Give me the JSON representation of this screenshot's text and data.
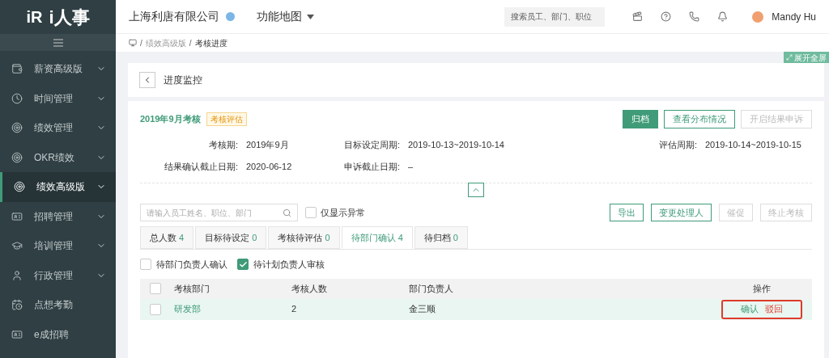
{
  "logo": {
    "mark": "iR",
    "text": "i人事"
  },
  "sidebar": {
    "items": [
      {
        "label": "薪资高级版",
        "expandable": true,
        "selected": false
      },
      {
        "label": "时间管理",
        "expandable": true,
        "selected": false
      },
      {
        "label": "绩效管理",
        "expandable": true,
        "selected": false
      },
      {
        "label": "OKR绩效",
        "expandable": true,
        "selected": false
      },
      {
        "label": "绩效高级版",
        "expandable": true,
        "selected": true
      },
      {
        "label": "招聘管理",
        "expandable": true,
        "selected": false
      },
      {
        "label": "培训管理",
        "expandable": true,
        "selected": false
      },
      {
        "label": "行政管理",
        "expandable": true,
        "selected": false
      },
      {
        "label": "点想考勤",
        "expandable": false,
        "selected": false
      },
      {
        "label": "e成招聘",
        "expandable": false,
        "selected": false
      }
    ]
  },
  "header": {
    "company": "上海利唐有限公司",
    "menu": "功能地图",
    "search_placeholder": "搜索员工、部门、职位",
    "user": "Mandy Hu"
  },
  "breadcrumb": {
    "separators": [
      "/",
      "/"
    ],
    "items": [
      "绩效高级版",
      "考核进度"
    ]
  },
  "fullscreen_button": "展开全屏",
  "page_title": "进度监控",
  "review": {
    "title": "2019年9月考核",
    "tag": "考核评估",
    "buttons": [
      {
        "label": "归档",
        "kind": "primary",
        "disabled": false
      },
      {
        "label": "查看分布情况",
        "kind": "outline",
        "disabled": false
      },
      {
        "label": "开启结果申诉",
        "kind": "outline",
        "disabled": true
      }
    ],
    "fields": [
      {
        "label": "考核期:",
        "value": "2019年9月"
      },
      {
        "label": "目标设定周期:",
        "value": "2019-10-13~2019-10-14"
      },
      {
        "label": "评估周期:",
        "value": "2019-10-14~2019-10-15"
      },
      {
        "label": "结果确认截止日期:",
        "value": "2020-06-12"
      },
      {
        "label": "申诉截止日期:",
        "value": "–"
      }
    ]
  },
  "filter": {
    "placeholder": "请输入员工姓名、职位、部门",
    "only_abnormal": {
      "label": "仅显示异常",
      "checked": false
    }
  },
  "actions": [
    {
      "label": "导出",
      "disabled": false
    },
    {
      "label": "变更处理人",
      "disabled": false
    },
    {
      "label": "催促",
      "disabled": true
    },
    {
      "label": "终止考核",
      "disabled": true
    }
  ],
  "tabs": [
    {
      "label": "总人数",
      "count": "4",
      "selected": false
    },
    {
      "label": "目标待设定",
      "count": "0",
      "selected": false
    },
    {
      "label": "考核待评估",
      "count": "0",
      "selected": false
    },
    {
      "label": "待部门确认",
      "count": "4",
      "selected": true
    },
    {
      "label": "待归档",
      "count": "0",
      "selected": false
    }
  ],
  "sub_filters": [
    {
      "label": "待部门负责人确认",
      "checked": false
    },
    {
      "label": "待计划负责人审核",
      "checked": true
    }
  ],
  "table": {
    "select_all_checked": false,
    "columns": [
      "考核部门",
      "考核人数",
      "部门负责人",
      "操作"
    ],
    "rows": [
      {
        "checked": false,
        "department": "研发部",
        "count": "2",
        "leader": "金三顺",
        "actions": [
          {
            "label": "确认",
            "kind": "confirm"
          },
          {
            "label": "驳回",
            "kind": "reject"
          }
        ]
      }
    ]
  }
}
